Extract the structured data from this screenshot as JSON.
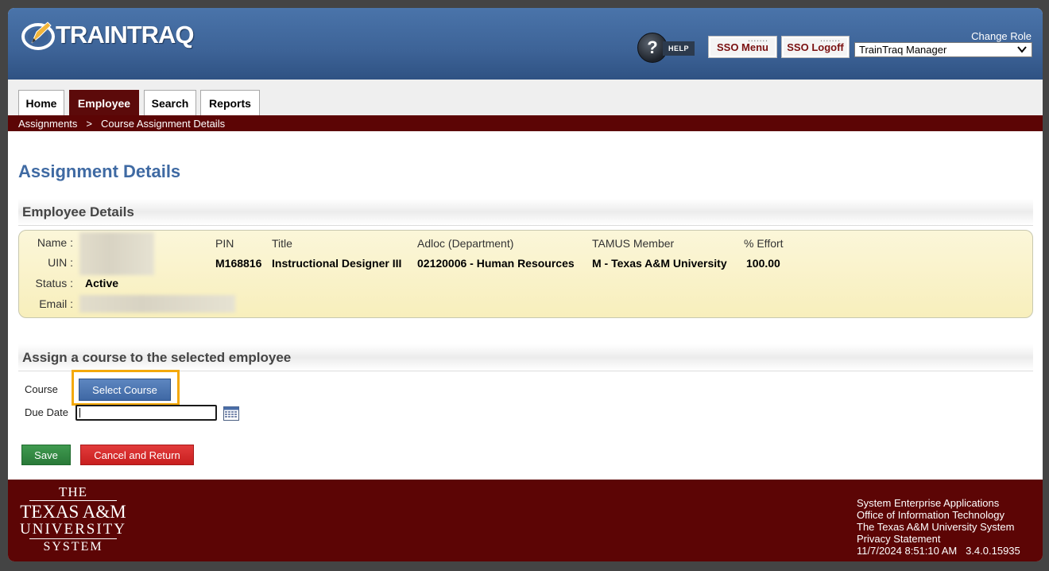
{
  "app": {
    "name": "TRAINTRAQ"
  },
  "header": {
    "help_label": "HELP",
    "sso_menu_label": "SSO Menu",
    "sso_logoff_label": "SSO Logoff",
    "change_role_label": "Change Role",
    "role_selected": "TrainTraq Manager"
  },
  "nav": {
    "tabs": [
      {
        "label": "Home"
      },
      {
        "label": "Employee",
        "active": true
      },
      {
        "label": "Search"
      },
      {
        "label": "Reports"
      }
    ]
  },
  "breadcrumb": {
    "items": [
      "Assignments",
      "Course Assignment Details"
    ],
    "separator": ">"
  },
  "page": {
    "title": "Assignment Details"
  },
  "employee_details": {
    "heading": "Employee Details",
    "labels": {
      "name": "Name :",
      "uin": "UIN :",
      "status": "Status :",
      "email": "Email :"
    },
    "status_value": "Active",
    "columns": {
      "pin": "PIN",
      "title": "Title",
      "adloc": "Adloc (Department)",
      "member": "TAMUS Member",
      "effort": "% Effort"
    },
    "row": {
      "pin": "M168816",
      "title": "Instructional Designer III",
      "adloc": "02120006 - Human Resources",
      "member": "M - Texas A&M University",
      "effort": "100.00"
    }
  },
  "assign_course": {
    "heading": "Assign a course to the selected employee",
    "course_label": "Course",
    "select_course_label": "Select Course",
    "due_date_label": "Due Date",
    "due_date_value": ""
  },
  "actions": {
    "save_label": "Save",
    "cancel_label": "Cancel and Return"
  },
  "footer": {
    "logo_lines": [
      "THE",
      "TEXAS A&M",
      "UNIVERSITY",
      "SYSTEM"
    ],
    "links": [
      "System Enterprise Applications",
      "Office of Information Technology",
      "The Texas A&M University System",
      "Privacy Statement"
    ],
    "timestamp": "11/7/2024 8:51:10 AM",
    "version": "3.4.0.15935"
  },
  "colors": {
    "header_blue": "#3d6397",
    "maroon": "#5c0505",
    "title_blue": "#3f6aa3",
    "highlight_orange": "#f4a90a",
    "save_green": "#2a7a39",
    "cancel_red": "#c81f1f"
  }
}
